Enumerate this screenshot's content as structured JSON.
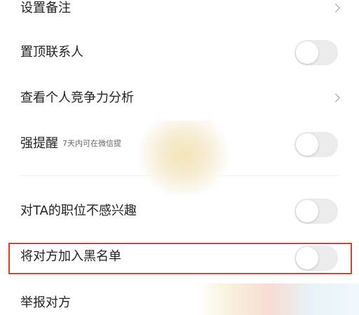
{
  "settings": {
    "remark": {
      "label": "设置备注"
    },
    "pin_contact": {
      "label": "置顶联系人",
      "on": false
    },
    "competitiveness": {
      "label": "查看个人竞争力分析"
    },
    "strong_reminder": {
      "label": "强提醒",
      "hint": "7天内可在微信提",
      "on": false
    },
    "not_interested": {
      "label": "对TA的职位不感兴趣",
      "on": false
    },
    "blacklist": {
      "label": "将对方加入黑名单",
      "on": false
    },
    "report": {
      "label": "举报对方"
    }
  },
  "icons": {
    "chevron": "chevron-right-icon",
    "toggle": "toggle-switch"
  },
  "colors": {
    "highlight_border": "#e53935",
    "toggle_off": "#ebebeb",
    "chevron": "#9a9a9a"
  }
}
